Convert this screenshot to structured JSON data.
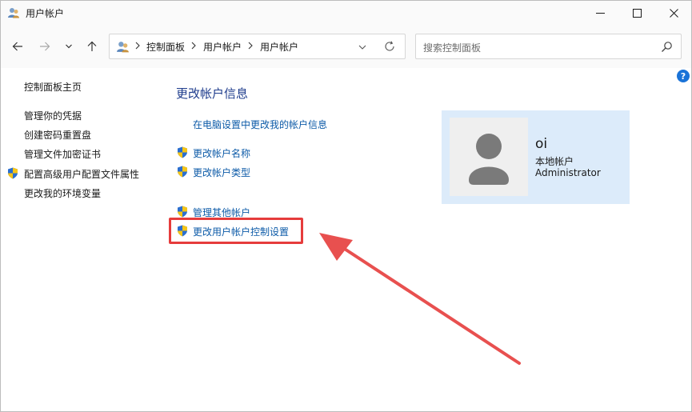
{
  "window": {
    "title": "用户帐户"
  },
  "nav": {
    "breadcrumbs": [
      "控制面板",
      "用户帐户",
      "用户帐户"
    ]
  },
  "search": {
    "placeholder": "搜索控制面板"
  },
  "sidebar": {
    "items": [
      {
        "label": "控制面板主页",
        "shield": false
      },
      {
        "label": "管理你的凭据",
        "shield": false
      },
      {
        "label": "创建密码重置盘",
        "shield": false
      },
      {
        "label": "管理文件加密证书",
        "shield": false
      },
      {
        "label": "配置高级用户配置文件属性",
        "shield": true
      },
      {
        "label": "更改我的环境变量",
        "shield": false
      }
    ]
  },
  "main": {
    "title": "更改帐户信息",
    "links": [
      {
        "label": "在电脑设置中更改我的帐户信息",
        "shield": false
      },
      {
        "label": "更改帐户名称",
        "shield": true
      },
      {
        "label": "更改帐户类型",
        "shield": true
      },
      {
        "label": "管理其他帐户",
        "shield": true
      },
      {
        "label": "更改用户帐户控制设置",
        "shield": true,
        "highlighted": true
      }
    ]
  },
  "account": {
    "name": "oi",
    "type": "本地帐户",
    "role": "Administrator"
  },
  "colors": {
    "link": "#0d5ba8",
    "title": "#1e3c8c",
    "card": "#dcebfa",
    "annotation": "#e63c3c"
  }
}
